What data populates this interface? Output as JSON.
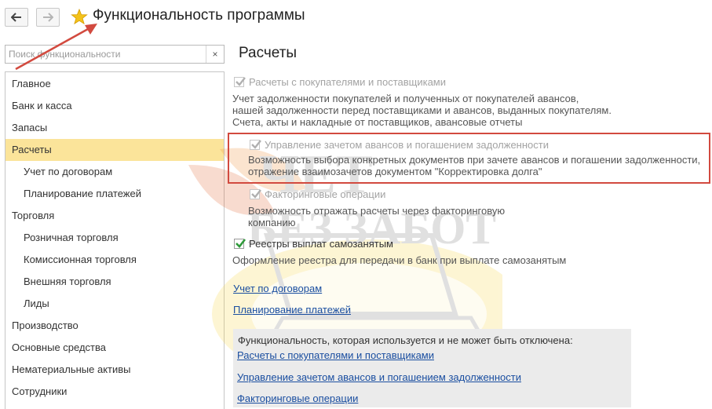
{
  "header": {
    "title": "Функциональность программы"
  },
  "search": {
    "placeholder": "Поиск функциональности"
  },
  "sidebar": {
    "items": [
      {
        "label": "Главное"
      },
      {
        "label": "Банк и касса"
      },
      {
        "label": "Запасы"
      },
      {
        "label": "Расчеты"
      },
      {
        "label": "Учет по договорам"
      },
      {
        "label": "Планирование платежей"
      },
      {
        "label": "Торговля"
      },
      {
        "label": "Розничная торговля"
      },
      {
        "label": "Комиссионная торговля"
      },
      {
        "label": "Внешняя торговля"
      },
      {
        "label": "Лиды"
      },
      {
        "label": "Производство"
      },
      {
        "label": "Основные средства"
      },
      {
        "label": "Нематериальные активы"
      },
      {
        "label": "Сотрудники"
      }
    ]
  },
  "main": {
    "section_title": "Расчеты",
    "options": [
      {
        "label": "Расчеты с покупателями и поставщиками",
        "checked": true,
        "enabled": false,
        "desc": [
          "Учет задолженности покупателей и полученных от покупателей авансов,",
          "нашей задолженности перед поставщиками и авансов, выданных покупателям.",
          "Счета, акты и накладные от поставщиков, авансовые отчеты"
        ]
      },
      {
        "label": "Управление зачетом авансов и погашением задолженности",
        "checked": true,
        "enabled": false,
        "desc": [
          "Возможность выбора конкретных документов при зачете авансов и погашении задолженности,",
          "отражение взаимозачетов документом \"Корректировка долга\""
        ]
      },
      {
        "label": "Факторинговые операции",
        "checked": true,
        "enabled": false,
        "desc": [
          "Возможность отражать расчеты через факторинговую",
          "компанию"
        ]
      },
      {
        "label": "Реестры выплат самозанятым",
        "checked": true,
        "enabled": true,
        "desc": [
          "Оформление реестра для передачи в банк при выплате самозанятым"
        ]
      }
    ],
    "links": [
      {
        "label": "Учет по договорам"
      },
      {
        "label": "Планирование платежей"
      }
    ],
    "fixed_box": {
      "heading": "Функциональность, которая используется и не может быть отключена:",
      "links": [
        {
          "label": "Расчеты с покупателями и поставщиками"
        },
        {
          "label": "Управление зачетом авансов и погашением задолженности"
        },
        {
          "label": "Факторинговые операции"
        }
      ]
    }
  },
  "colors": {
    "selected_row": "#fbe49a",
    "link": "#1a4ea0",
    "highlight_border": "#d24a3f",
    "annotation_arrow": "#d24a3f"
  }
}
